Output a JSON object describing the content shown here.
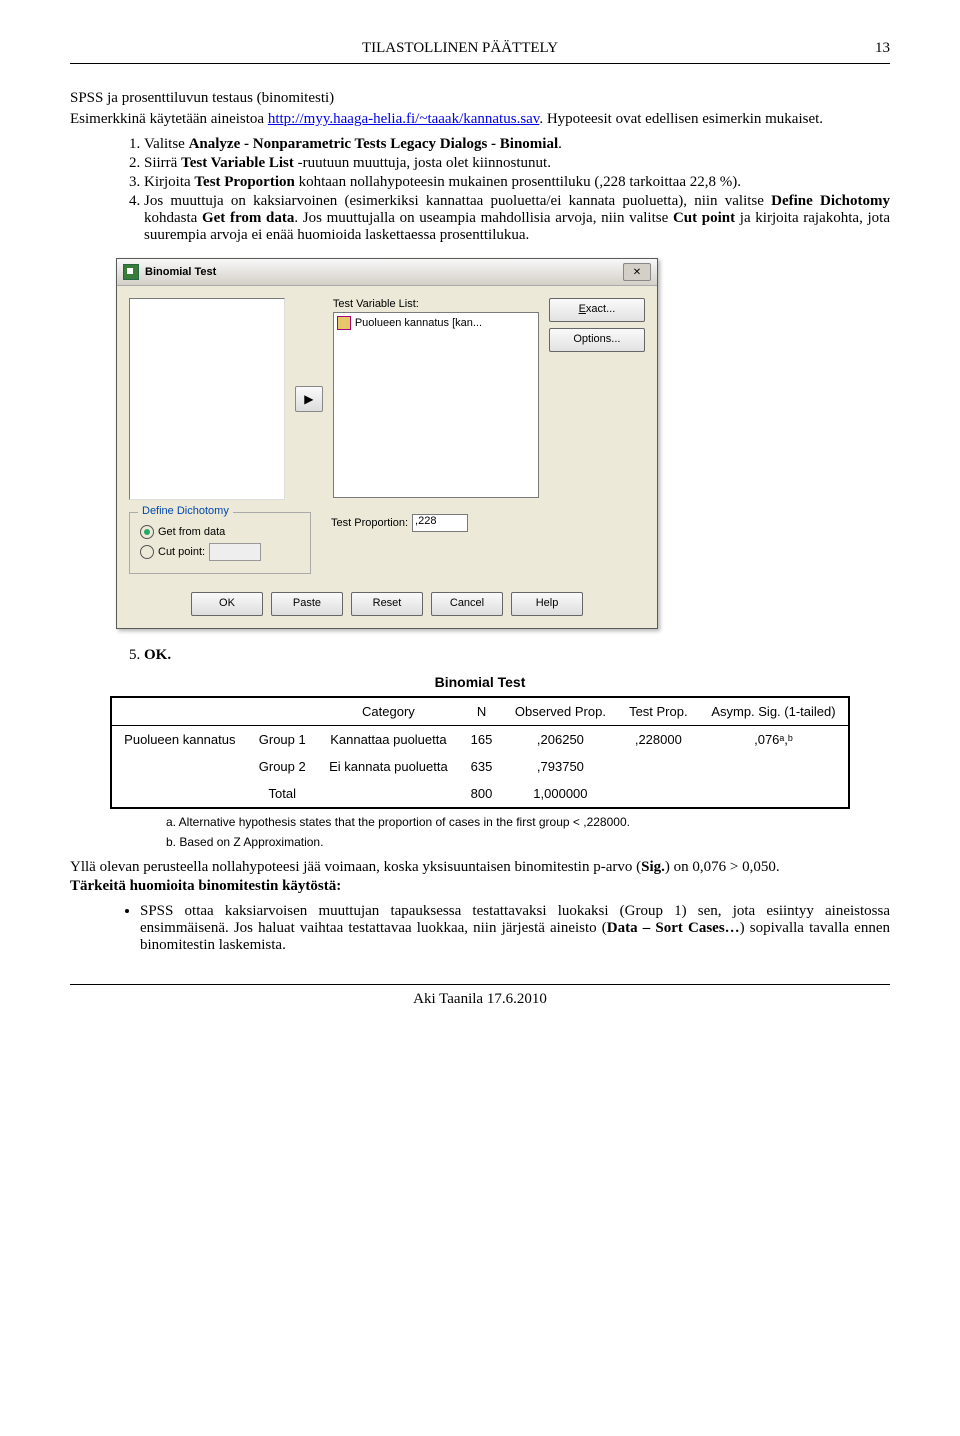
{
  "header": {
    "title": "TILASTOLLINEN PÄÄTTELY",
    "page": "13"
  },
  "section_title": "SPSS ja prosenttiluvun testaus (binomitesti)",
  "intro": {
    "pre": "Esimerkkinä   käytetään   aineistoa   ",
    "link": "http://myy.haaga-helia.fi/~taaak/kannatus.sav",
    "post": ". Hypoteesit ovat edellisen esimerkin mukaiset."
  },
  "steps": [
    {
      "n": "1.",
      "t1": "Valitse ",
      "b1": "Analyze - Nonparametric Tests Legacy Dialogs - Binomial",
      "t2": "."
    },
    {
      "n": "2.",
      "t1": "Siirrä ",
      "b1": "Test Variable List",
      "t2": " -ruutuun muuttuja, josta olet kiinnostunut."
    },
    {
      "n": "3.",
      "t1": "Kirjoita ",
      "b1": "Test Proportion",
      "t2": " kohtaan nollahypoteesin mukainen prosenttiluku (,228 tarkoittaa 22,8 %)."
    },
    {
      "n": "4.",
      "t1": "Jos muuttuja on kaksiarvoinen (esimerkiksi kannattaa puoluetta/ei kannata puoluetta), niin valitse ",
      "b1": "Define Dichotomy",
      "t2": " kohdasta ",
      "b2": "Get from data",
      "t3": ". Jos muuttujalla on useampia mahdollisia arvoja, niin valitse ",
      "b3": "Cut point",
      "t4": " ja kirjoita rajakohta, jota suurempia arvoja ei enää huomioida laskettaessa prosenttilukua."
    }
  ],
  "dialog": {
    "title": "Binomial Test",
    "target_label": "Test Variable List:",
    "var_item": "Puolueen kannatus [kan...",
    "exact_btn": "Exact...",
    "options_btn": "Options...",
    "group_title": "Define Dichotomy",
    "radio_get": "Get from data",
    "radio_cut": "Cut point:",
    "testprop_lbl": "Test Proportion:",
    "testprop_val": ",228",
    "ok": "OK",
    "paste": "Paste",
    "reset": "Reset",
    "cancel": "Cancel",
    "help": "Help"
  },
  "step5": "OK.",
  "output": {
    "title": "Binomial Test",
    "cols": [
      "",
      "",
      "Category",
      "N",
      "Observed Prop.",
      "Test Prop.",
      "Asymp. Sig. (1-tailed)"
    ],
    "rows": [
      {
        "rlabel": "Puolueen kannatus",
        "group": "Group 1",
        "cat": "Kannattaa puoluetta",
        "n": "165",
        "obs": ",206250",
        "test": ",228000",
        "sig": ",076ᵃ,ᵇ"
      },
      {
        "rlabel": "",
        "group": "Group 2",
        "cat": "Ei kannata puoluetta",
        "n": "635",
        "obs": ",793750",
        "test": "",
        "sig": ""
      },
      {
        "rlabel": "",
        "group": "Total",
        "cat": "",
        "n": "800",
        "obs": "1,000000",
        "test": "",
        "sig": ""
      }
    ],
    "note_a": "a. Alternative hypothesis states that the proportion of cases in the first group < ,228000.",
    "note_b": "b. Based on Z Approximation."
  },
  "after_output": "Yllä olevan perusteella nollahypoteesi jää voimaan, koska yksisuuntaisen binomitestin p-arvo (",
  "after_output_b": "Sig.",
  "after_output_end": ") on 0,076 > 0,050.",
  "important_title": "Tärkeitä huomioita binomitestin käytöstä:",
  "bullet": {
    "t1": "SPSS ottaa kaksiarvoisen muuttujan tapauksessa testattavaksi luokaksi (Group 1) sen, jota esiintyy aineistossa ensimmäisenä. Jos haluat vaihtaa testattavaa luokkaa, niin järjestä aineisto (",
    "b1": "Data – Sort Cases…",
    "t2": ") sopivalla tavalla ennen binomitestin laskemista."
  },
  "footer": "Aki Taanila 17.6.2010"
}
